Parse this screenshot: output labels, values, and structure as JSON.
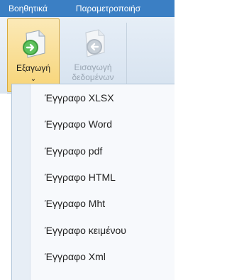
{
  "tabs": [
    "Βοηθητικά",
    "Παραμετροποιήσ"
  ],
  "ribbon": {
    "export_label": "Εξαγωγή",
    "export_caret": "⌄",
    "import_label_line1": "Εισαγωγή",
    "import_label_line2": "δεδομένων"
  },
  "menu": {
    "items": [
      "Έγγραφο XLSX",
      "Έγγραφο Word",
      "Έγγραφο pdf",
      "Έγγραφο HTML",
      "Έγγραφο Mht",
      "Έγγραφο κειμένου",
      "Έγγραφο Xml"
    ]
  },
  "colors": {
    "tabbar": "#3b7fc4",
    "export_highlight": "#f7d476",
    "icon_green": "#4caf50",
    "icon_disabled": "#b9c2cc"
  },
  "icons": {
    "export": "export-document-icon",
    "import": "import-data-icon"
  }
}
